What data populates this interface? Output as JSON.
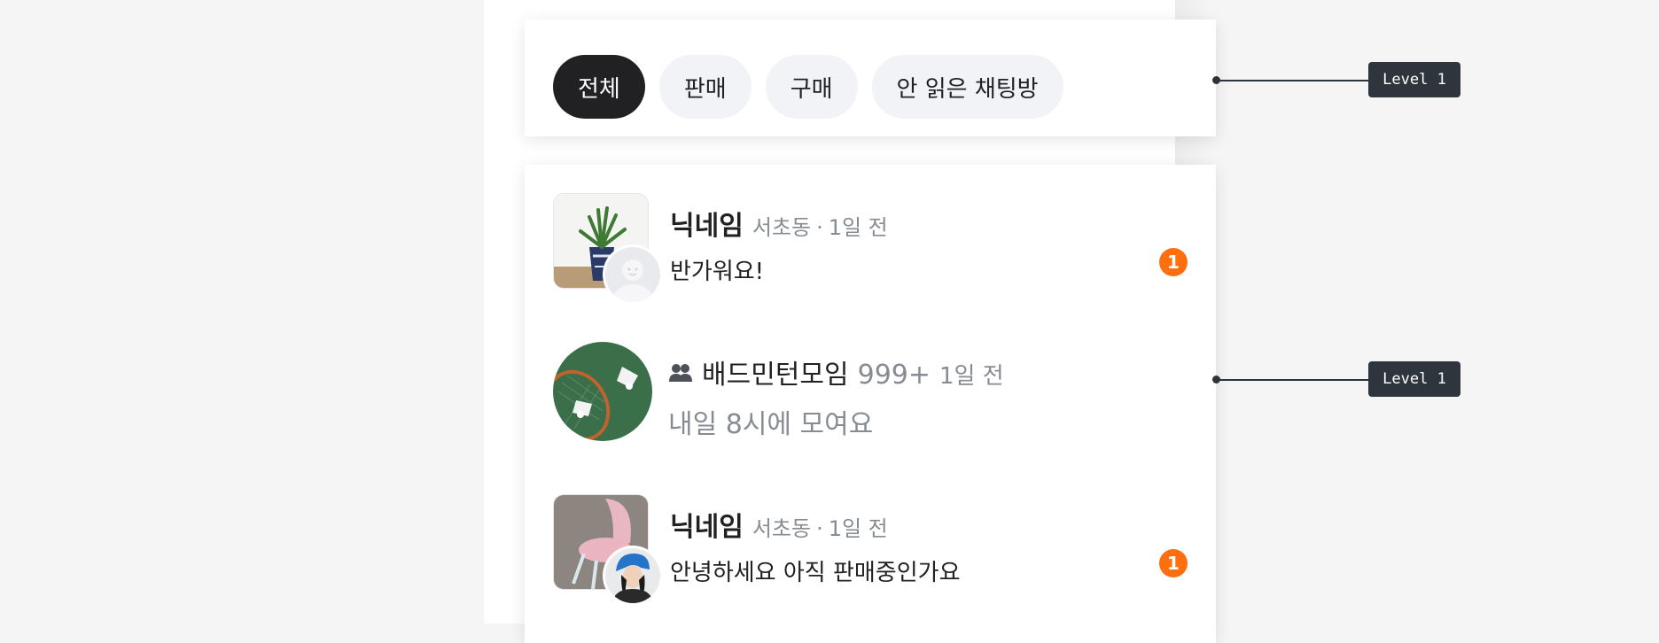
{
  "filters": {
    "chips": [
      {
        "label": "전체",
        "active": true
      },
      {
        "label": "판매",
        "active": false
      },
      {
        "label": "구매",
        "active": false
      },
      {
        "label": "안 읽은 채팅방",
        "active": false
      }
    ]
  },
  "chats": [
    {
      "type": "direct",
      "nickname": "닉네임",
      "location": "서초동",
      "separator": "·",
      "time": "1일 전",
      "message": "반가워요!",
      "unread": "1",
      "thumbnail_icon": "plant-photo",
      "avatar_icon": "default-profile-icon"
    },
    {
      "type": "group",
      "group_icon": "people-icon",
      "group_name": "배드민턴모임",
      "member_count": "999+",
      "time": "1일 전",
      "message": "내일 8시에 모여요",
      "thumbnail_icon": "badminton-photo"
    },
    {
      "type": "direct",
      "nickname": "닉네임",
      "location": "서초동",
      "separator": "·",
      "time": "1일 전",
      "message": "안녕하세요 아직 판매중인가요",
      "unread": "1",
      "thumbnail_icon": "chair-photo",
      "avatar_icon": "user-photo"
    }
  ],
  "annotations": [
    {
      "label": "Level 1"
    },
    {
      "label": "Level 1"
    }
  ],
  "colors": {
    "accent": "#ff6f0f",
    "chip_active": "#212124",
    "chip_inactive": "#f2f3f6",
    "muted_text": "#868b94",
    "background": "#f5f5f5",
    "annotation": "#2f353d"
  }
}
